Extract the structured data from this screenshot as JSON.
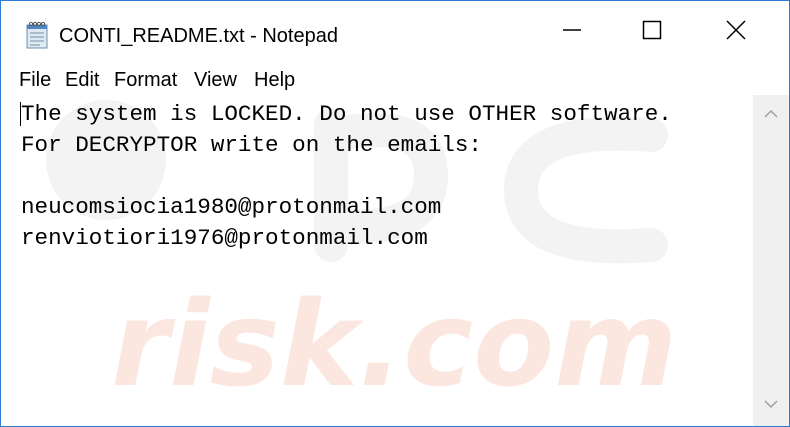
{
  "window": {
    "title": "CONTI_README.txt - Notepad"
  },
  "menu": {
    "file": "File",
    "edit": "Edit",
    "format": "Format",
    "view": "View",
    "help": "Help"
  },
  "document": {
    "lines": [
      "The system is LOCKED. Do not use OTHER software.",
      "For DECRYPTOR write on the emails:",
      "",
      "neucomsiocia1980@protonmail.com",
      "renviotiori1976@protonmail.com"
    ]
  },
  "icons": {
    "app": "notepad-icon",
    "minimize": "minimize-icon",
    "maximize": "maximize-icon",
    "close": "close-icon",
    "scroll_up": "chevron-up-icon",
    "scroll_down": "chevron-down-icon"
  },
  "colors": {
    "window_border": "#2b7cd3",
    "scrollbar_track": "#f0f0f0"
  }
}
